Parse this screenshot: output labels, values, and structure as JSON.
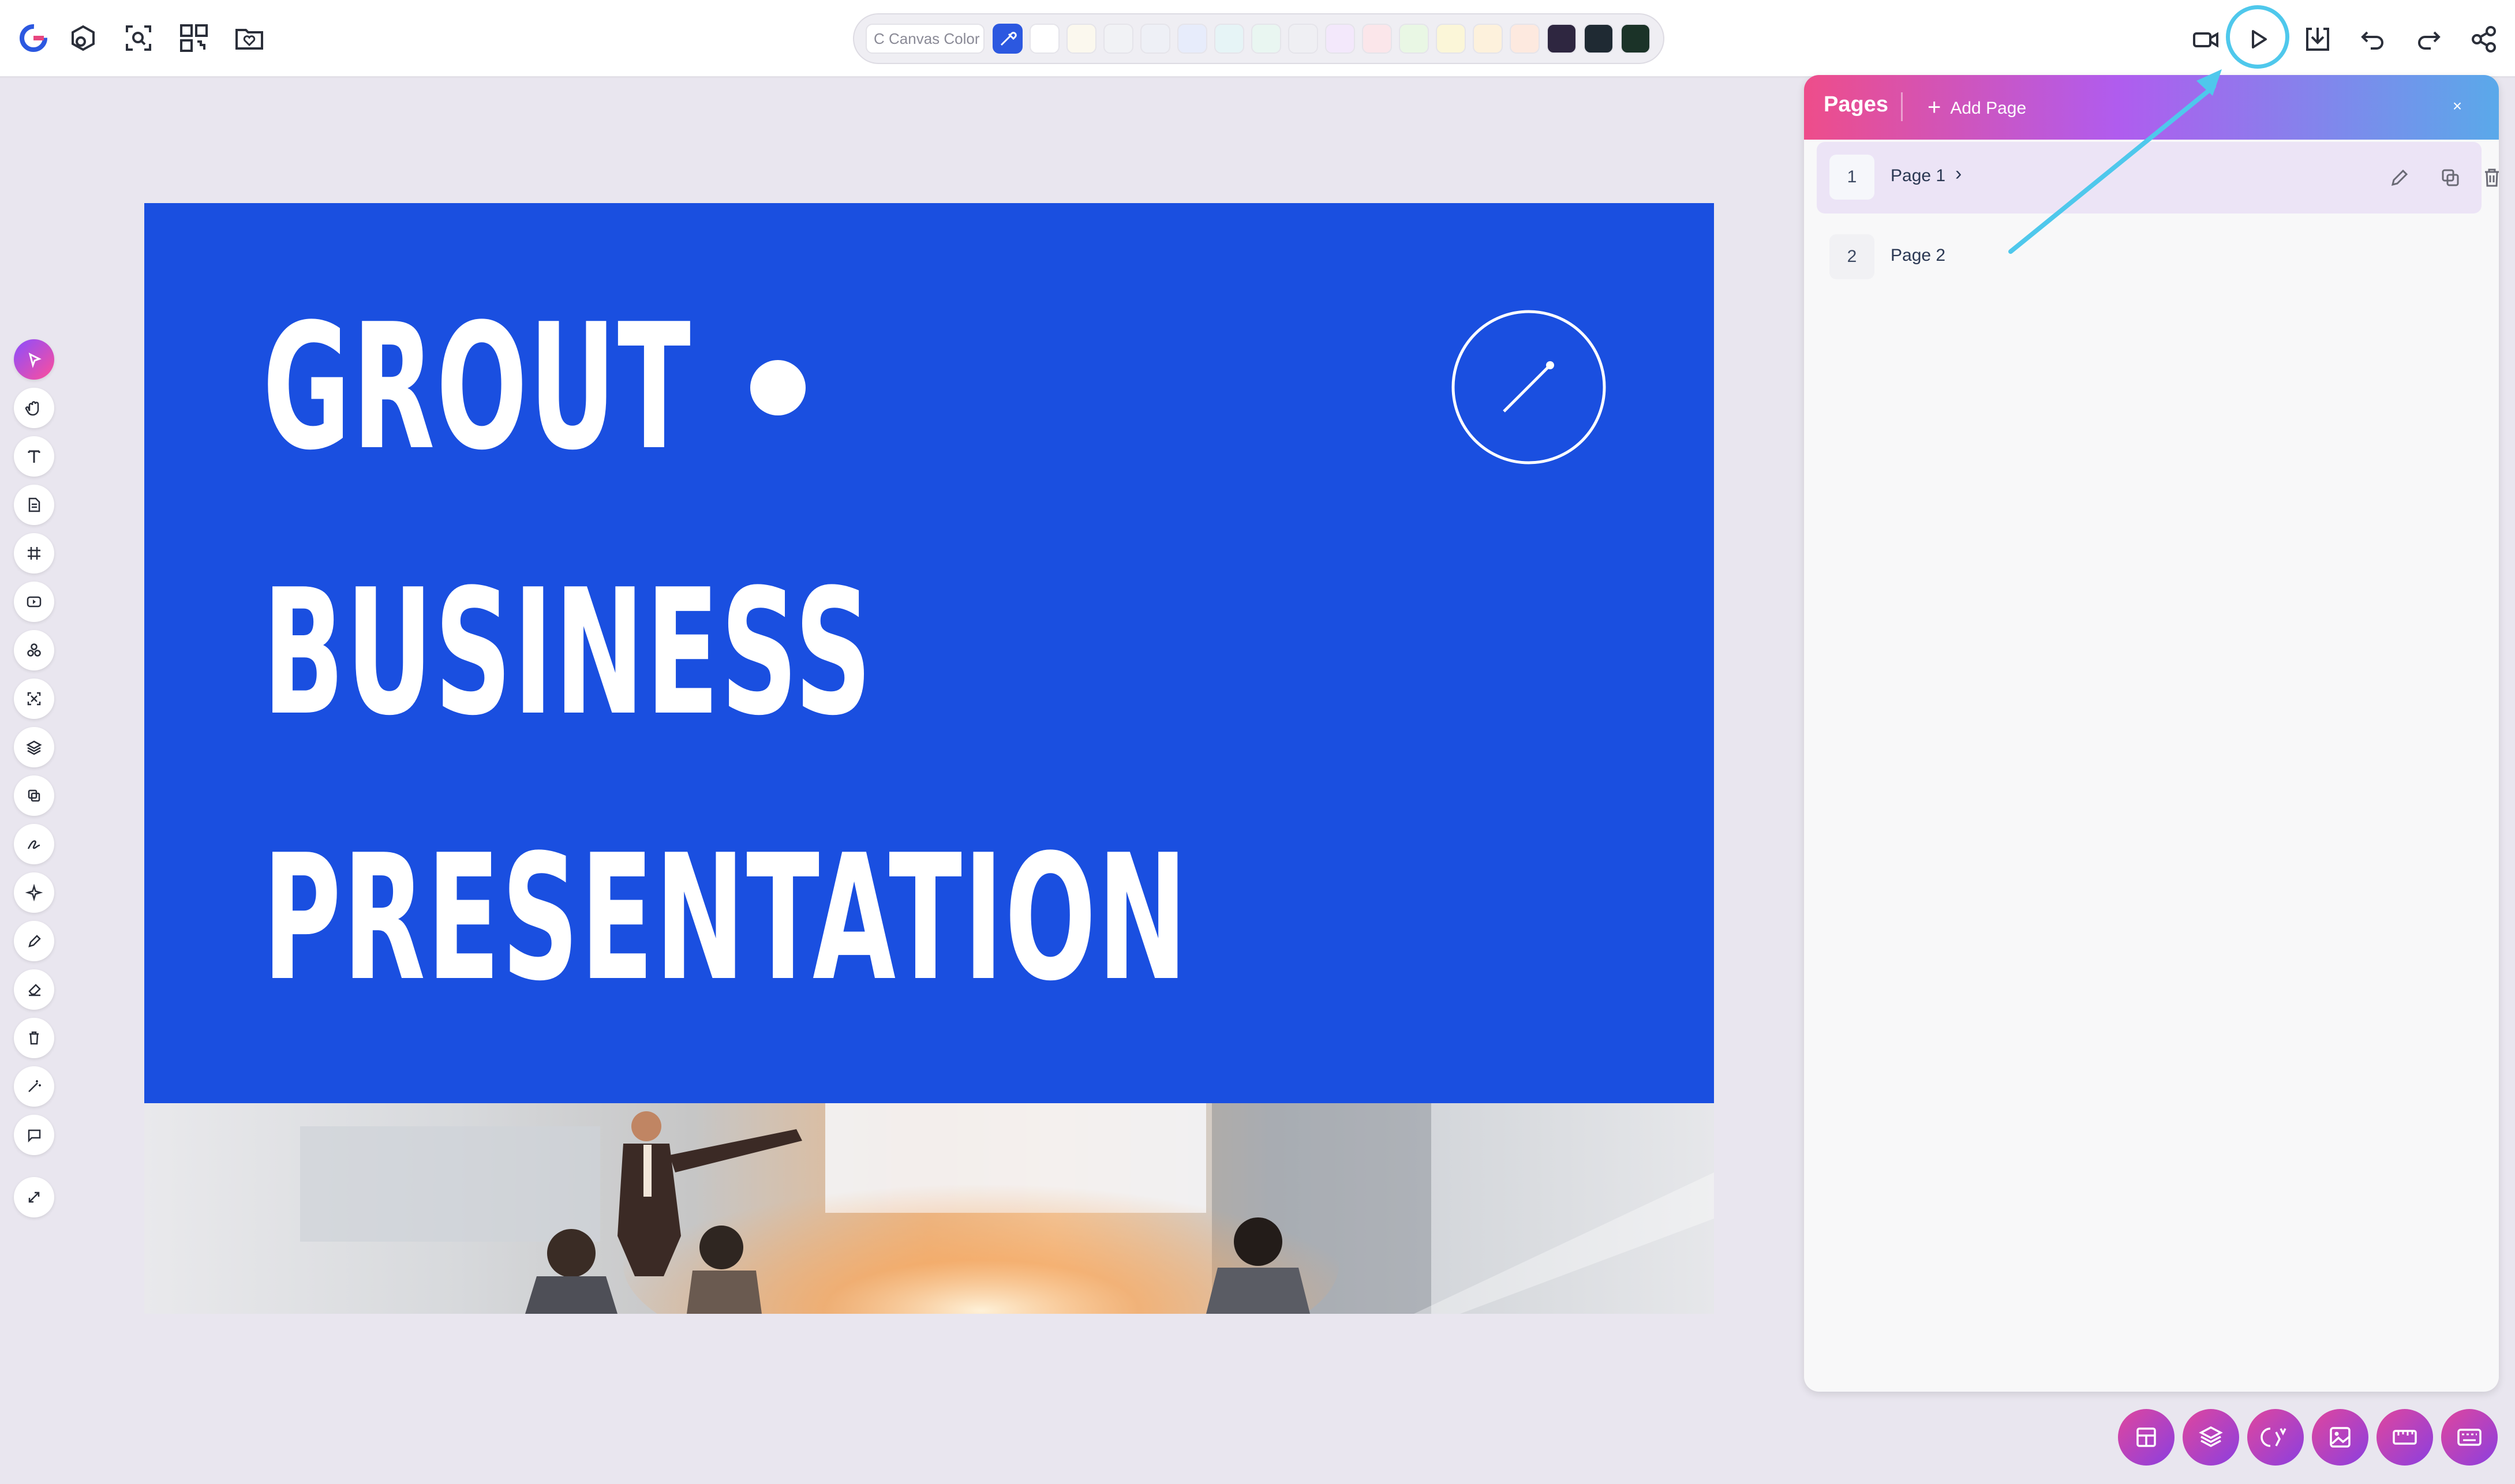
{
  "top_bar": {
    "palette": {
      "canvas_color_label": "C Canvas Color",
      "swatches": [
        "#ffffff",
        "#fbf8ee",
        "#f1f2f5",
        "#eef0f6",
        "#e7ecfb",
        "#e6f4f6",
        "#e9f6f1",
        "#efeff3",
        "#f3e8fb",
        "#fbe6ea",
        "#e9f7e4",
        "#fbf6d8",
        "#fdf1dc",
        "#fde9df",
        "#2e2640",
        "#1f2a33",
        "#1b3328"
      ]
    }
  },
  "slide": {
    "line1": "GROUT",
    "line2": "BUSINESS",
    "line3": "PRESENTATION",
    "background_color": "#1a4fe0"
  },
  "pages_panel": {
    "title": "Pages",
    "add_page_label": "Add Page",
    "close_label": "×",
    "pages": [
      {
        "number": "1",
        "label": "Page 1"
      },
      {
        "number": "2",
        "label": "Page 2"
      }
    ]
  },
  "colors": {
    "accent_blue": "#2c58e0",
    "highlight_cyan": "#4fc8ec"
  }
}
